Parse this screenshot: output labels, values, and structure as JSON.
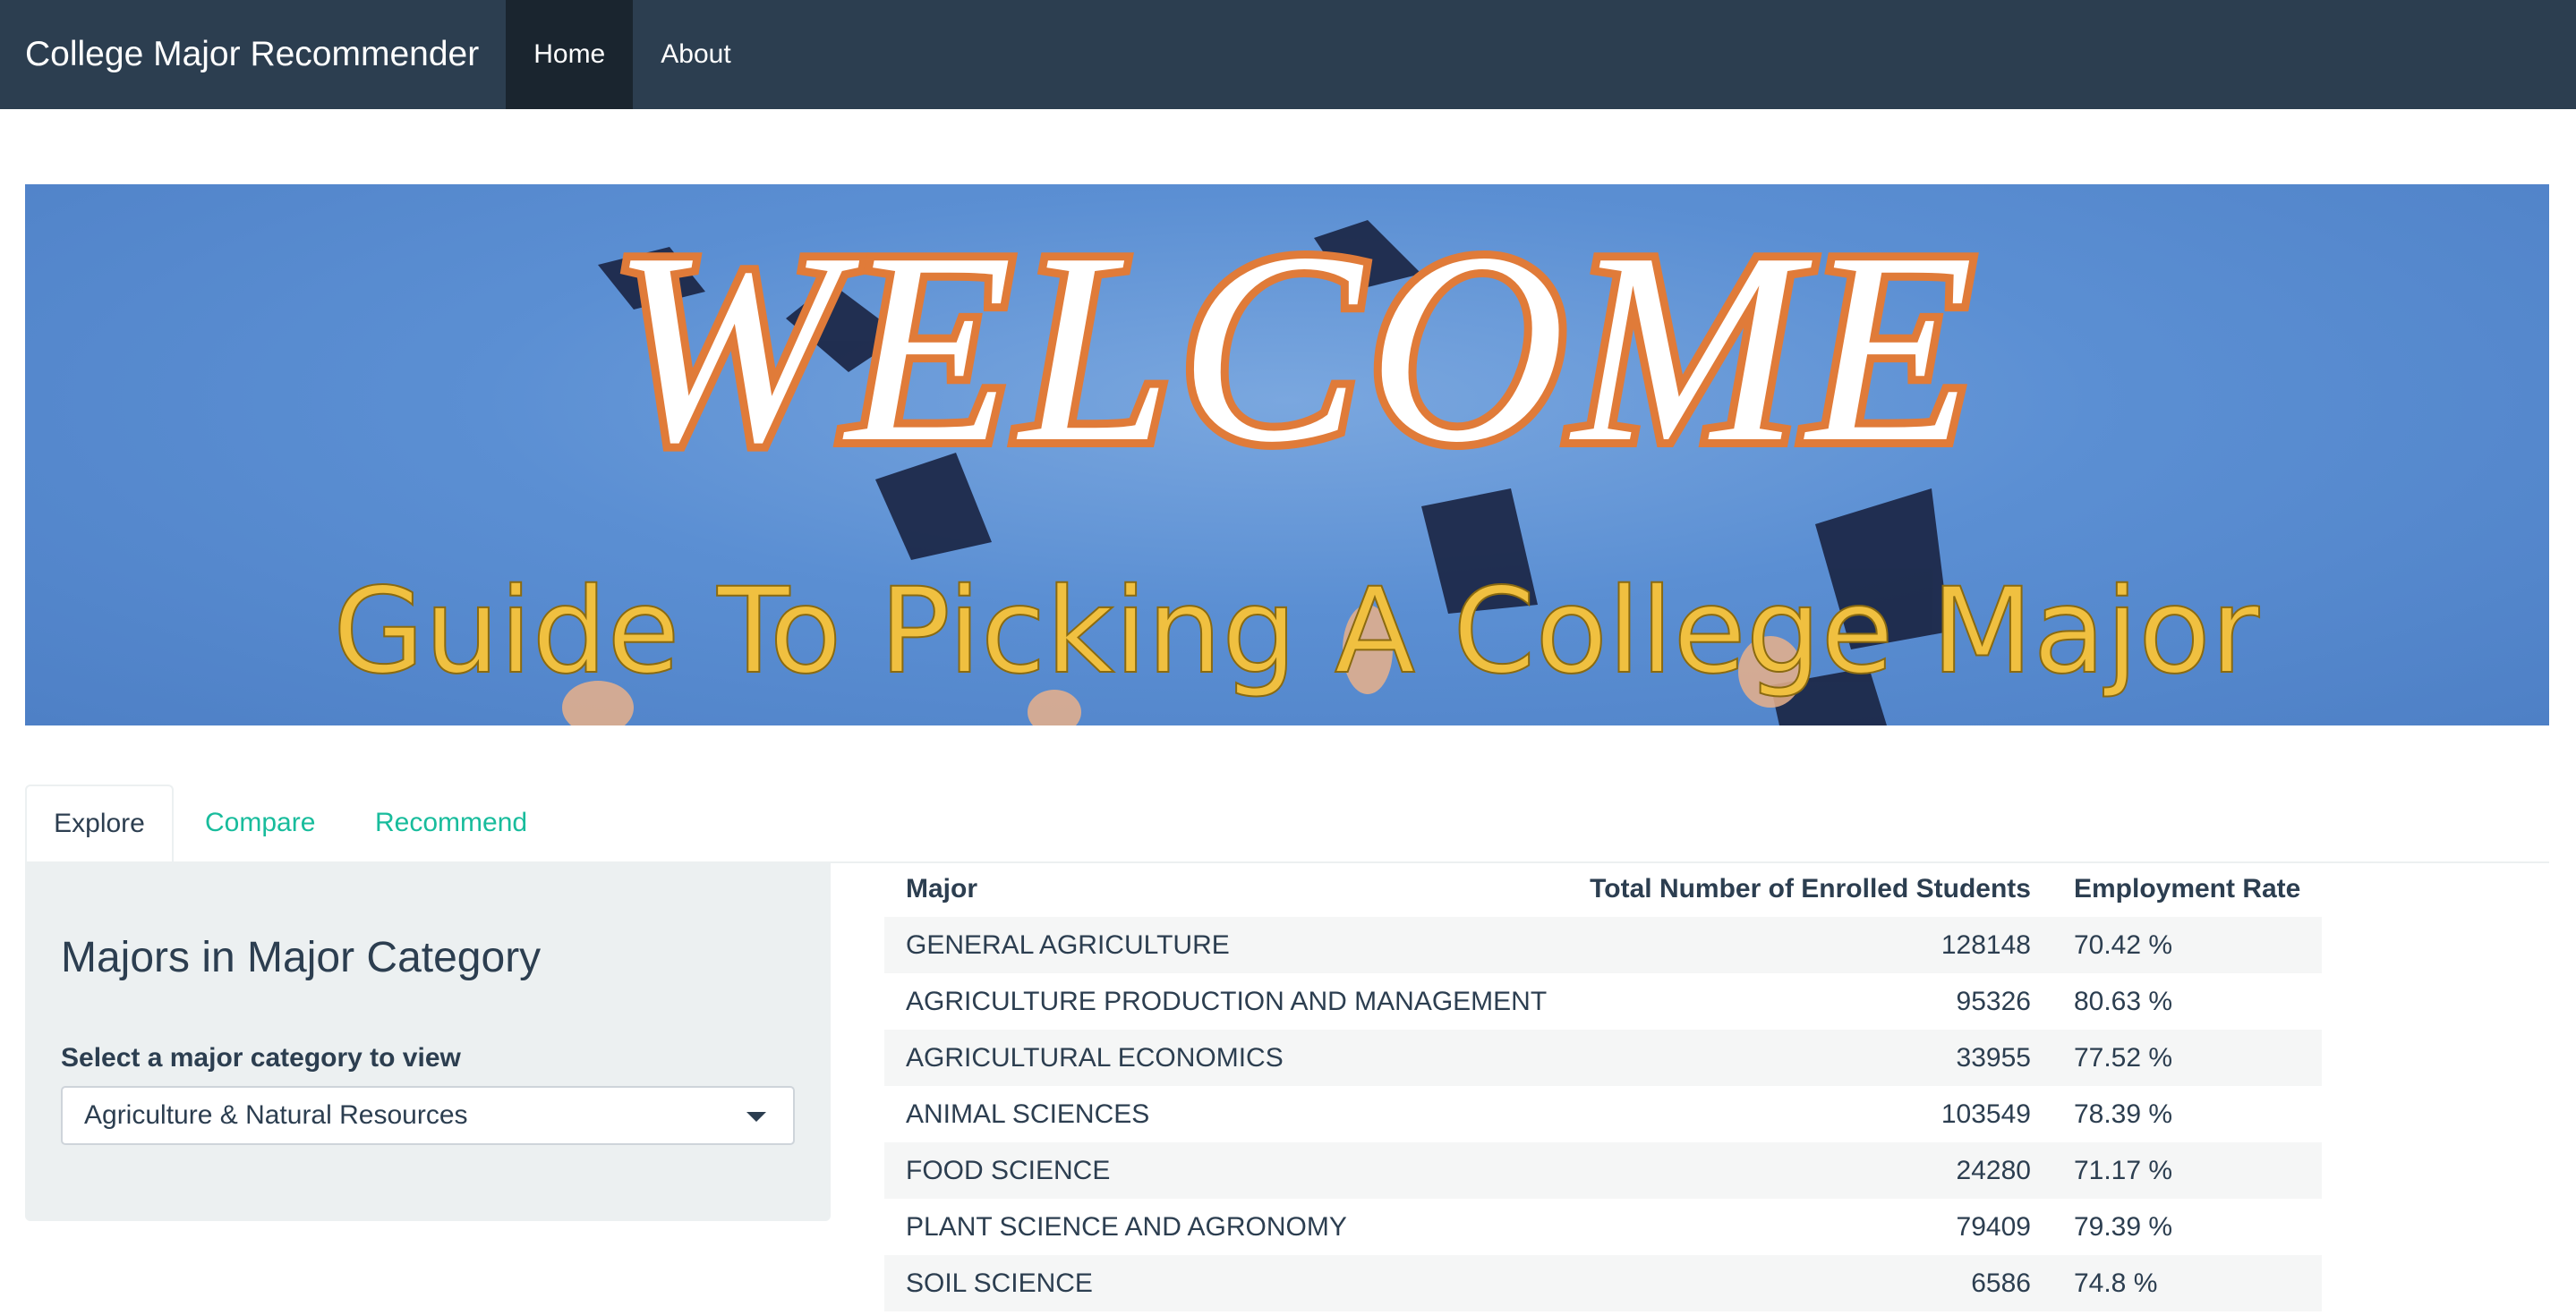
{
  "navbar": {
    "brand": "College Major Recommender",
    "items": [
      {
        "label": "Home",
        "active": true
      },
      {
        "label": "About",
        "active": false
      }
    ]
  },
  "banner": {
    "headline": "WELCOME",
    "subheadline": "Guide To Picking A College Major"
  },
  "tabs": [
    {
      "label": "Explore",
      "active": true
    },
    {
      "label": "Compare",
      "active": false
    },
    {
      "label": "Recommend",
      "active": false
    }
  ],
  "sidebar": {
    "title": "Majors in Major Category",
    "select_label": "Select a major category to view",
    "select_value": "Agriculture & Natural Resources"
  },
  "table": {
    "headers": [
      "Major",
      "Total Number of Enrolled Students",
      "Employment Rate"
    ],
    "rows": [
      [
        "GENERAL AGRICULTURE",
        "128148",
        "70.42 %"
      ],
      [
        "AGRICULTURE PRODUCTION AND MANAGEMENT",
        "95326",
        "80.63 %"
      ],
      [
        "AGRICULTURAL ECONOMICS",
        "33955",
        "77.52 %"
      ],
      [
        "ANIMAL SCIENCES",
        "103549",
        "78.39 %"
      ],
      [
        "FOOD SCIENCE",
        "24280",
        "71.17 %"
      ],
      [
        "PLANT SCIENCE AND AGRONOMY",
        "79409",
        "79.39 %"
      ],
      [
        "SOIL SCIENCE",
        "6586",
        "74.8 %"
      ]
    ]
  },
  "colors": {
    "navbar": "#2c3e50",
    "navbar_active": "#1a252f",
    "tab_link": "#18bc9c",
    "panel": "#ecf0f1",
    "banner_sky": "#5b8fd3",
    "welcome_fill": "#ffffff",
    "welcome_stroke": "#e07b39",
    "subheadline": "#f0c040"
  }
}
